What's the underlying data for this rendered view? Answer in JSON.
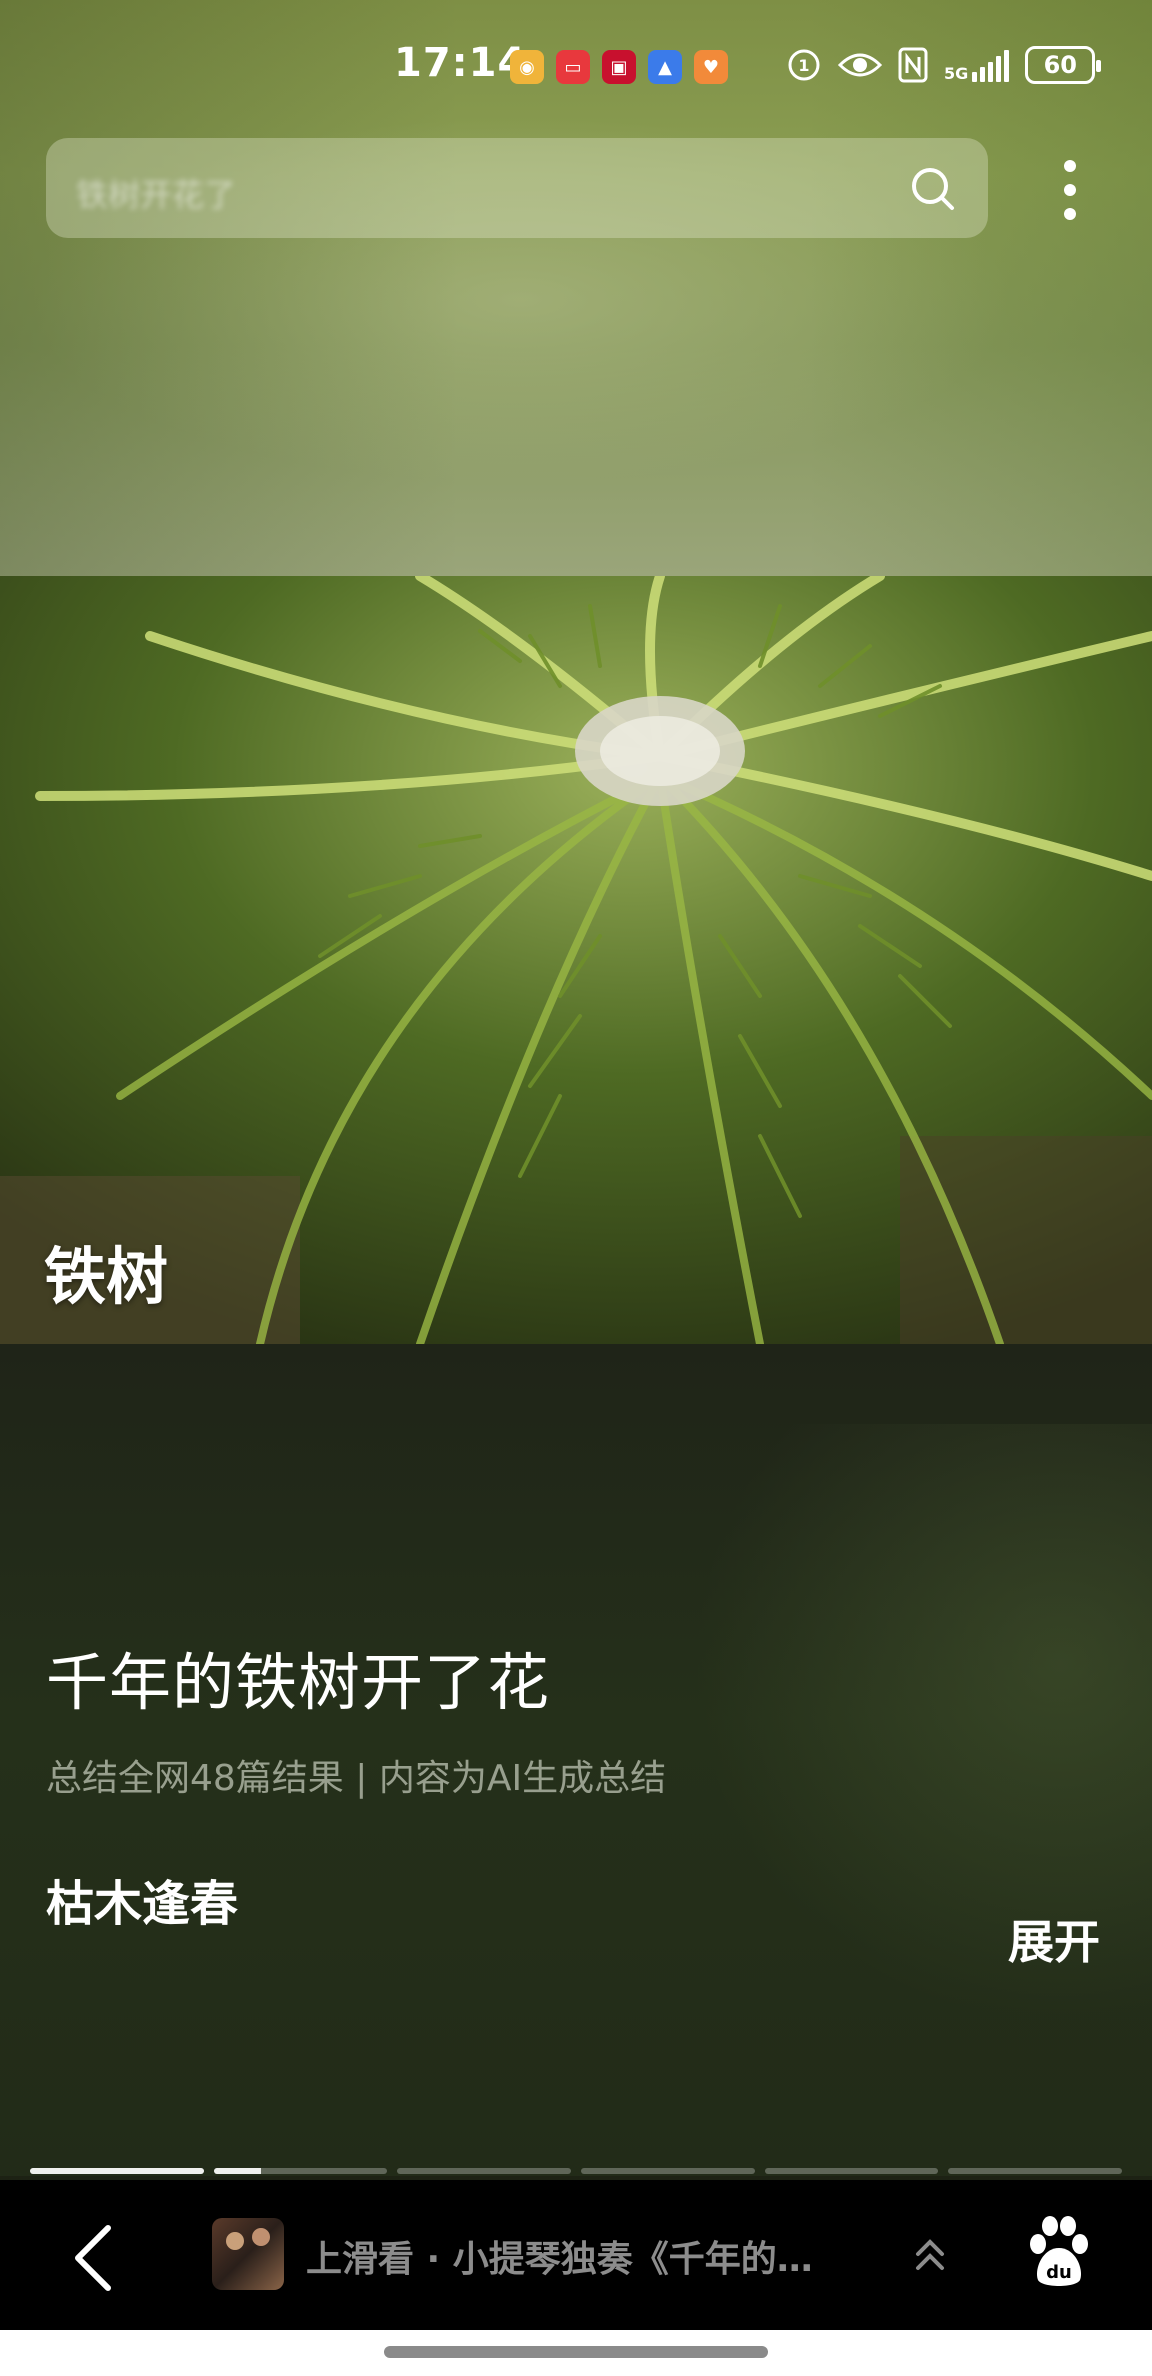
{
  "status_bar": {
    "time": "17:14",
    "battery": "60",
    "network": "5G",
    "notification_icons": [
      "weibo-icon",
      "book-app-icon",
      "news-app-icon",
      "photo-app-icon",
      "health-app-icon"
    ],
    "system_icons": [
      "hd-call-icon",
      "eye-icon",
      "nfc-icon",
      "signal-icon"
    ]
  },
  "search": {
    "placeholder": "铁树开花了"
  },
  "hero": {
    "caption": "铁树"
  },
  "article": {
    "headline": "千年的铁树开了花",
    "subline": "总结全网48篇结果 | 内容为AI生成总结",
    "section_title": "枯木逢春",
    "expand_label": "展开"
  },
  "progress": {
    "segments": 6,
    "current_index": 1,
    "current_fraction": 0.27
  },
  "bottom_bar": {
    "text": "上滑看 · 小提琴独奏《千年的…"
  },
  "colors": {
    "top_bg": "#8a9d52",
    "content_bg": "#1f2418",
    "bottom_bar": "#000000"
  }
}
